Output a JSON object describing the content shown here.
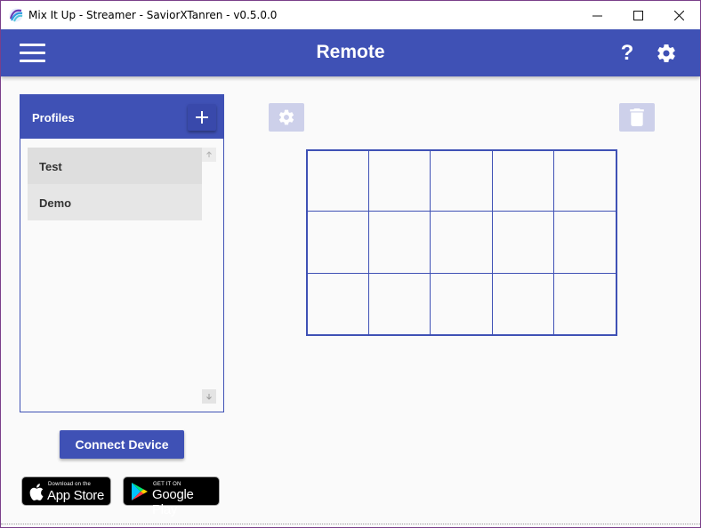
{
  "window": {
    "title": "Mix It Up - Streamer - SaviorXTanren - v0.5.0.0",
    "minimize_symbol": "—",
    "close_symbol": "✕"
  },
  "appbar": {
    "title": "Remote",
    "help_label": "?"
  },
  "profiles": {
    "title": "Profiles",
    "add_label": "+",
    "items": [
      {
        "name": "Test",
        "selected": true
      },
      {
        "name": "Demo",
        "selected": false
      }
    ]
  },
  "connect_button": {
    "label": "Connect Device"
  },
  "badges": {
    "apple": {
      "small": "Download on the",
      "big": "App Store"
    },
    "google": {
      "small": "GET IT ON",
      "big": "Google Play"
    }
  },
  "grid": {
    "columns": 5,
    "rows": 3
  },
  "colors": {
    "primary": "#3f51b5",
    "disabled_button": "#cdd0ea",
    "item_background": "#e6e6e6"
  },
  "icons": {
    "app": "mix-it-up-logo-icon",
    "menu": "hamburger-menu-icon",
    "settings": "gear-icon",
    "delete": "trash-icon",
    "scroll_up": "arrow-up-icon",
    "scroll_down": "arrow-down-icon"
  }
}
